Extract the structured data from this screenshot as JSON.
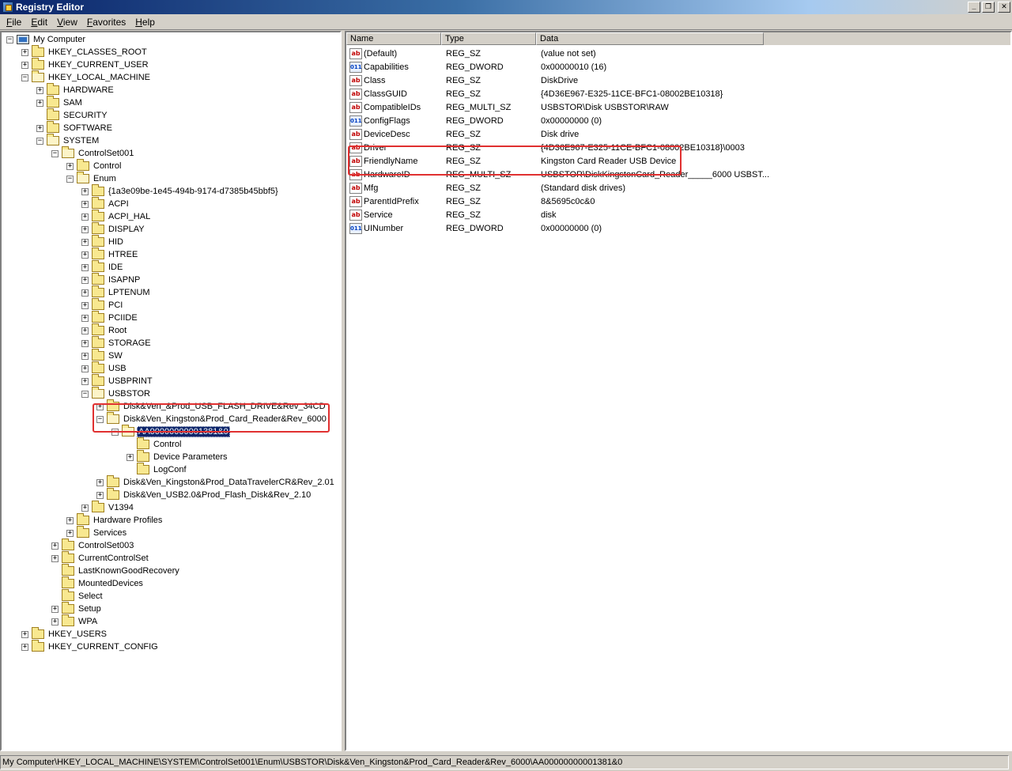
{
  "window": {
    "title": "Registry Editor",
    "icon": "registry-editor-icon",
    "minimize_glyph": "_",
    "maximize_glyph": "❐",
    "close_glyph": "✕"
  },
  "menu": [
    {
      "key": "F",
      "rest": "ile"
    },
    {
      "key": "E",
      "rest": "dit"
    },
    {
      "key": "V",
      "rest": "iew"
    },
    {
      "key": "F",
      "rest": "avorites",
      "prefix": ""
    },
    {
      "key": "H",
      "rest": "elp"
    }
  ],
  "menu_labels": [
    "File",
    "Edit",
    "View",
    "Favorites",
    "Help"
  ],
  "tree": [
    {
      "label": "My Computer",
      "level": 0,
      "expander": "-",
      "icon": "computer-icon"
    },
    {
      "label": "HKEY_CLASSES_ROOT",
      "level": 1,
      "expander": "+"
    },
    {
      "label": "HKEY_CURRENT_USER",
      "level": 1,
      "expander": "+"
    },
    {
      "label": "HKEY_LOCAL_MACHINE",
      "level": 1,
      "expander": "-"
    },
    {
      "label": "HARDWARE",
      "level": 2,
      "expander": "+"
    },
    {
      "label": "SAM",
      "level": 2,
      "expander": "+"
    },
    {
      "label": "SECURITY",
      "level": 2,
      "expander": ""
    },
    {
      "label": "SOFTWARE",
      "level": 2,
      "expander": "+"
    },
    {
      "label": "SYSTEM",
      "level": 2,
      "expander": "-"
    },
    {
      "label": "ControlSet001",
      "level": 3,
      "expander": "-"
    },
    {
      "label": "Control",
      "level": 4,
      "expander": "+"
    },
    {
      "label": "Enum",
      "level": 4,
      "expander": "-"
    },
    {
      "label": "{1a3e09be-1e45-494b-9174-d7385b45bbf5}",
      "level": 5,
      "expander": "+"
    },
    {
      "label": "ACPI",
      "level": 5,
      "expander": "+"
    },
    {
      "label": "ACPI_HAL",
      "level": 5,
      "expander": "+"
    },
    {
      "label": "DISPLAY",
      "level": 5,
      "expander": "+"
    },
    {
      "label": "HID",
      "level": 5,
      "expander": "+"
    },
    {
      "label": "HTREE",
      "level": 5,
      "expander": "+"
    },
    {
      "label": "IDE",
      "level": 5,
      "expander": "+"
    },
    {
      "label": "ISAPNP",
      "level": 5,
      "expander": "+"
    },
    {
      "label": "LPTENUM",
      "level": 5,
      "expander": "+"
    },
    {
      "label": "PCI",
      "level": 5,
      "expander": "+"
    },
    {
      "label": "PCIIDE",
      "level": 5,
      "expander": "+"
    },
    {
      "label": "Root",
      "level": 5,
      "expander": "+"
    },
    {
      "label": "STORAGE",
      "level": 5,
      "expander": "+"
    },
    {
      "label": "SW",
      "level": 5,
      "expander": "+"
    },
    {
      "label": "USB",
      "level": 5,
      "expander": "+"
    },
    {
      "label": "USBPRINT",
      "level": 5,
      "expander": "+"
    },
    {
      "label": "USBSTOR",
      "level": 5,
      "expander": "-"
    },
    {
      "label": "Disk&Ven_&Prod_USB_FLASH_DRIVE&Rev_34CD",
      "level": 6,
      "expander": "+"
    },
    {
      "label": "Disk&Ven_Kingston&Prod_Card_Reader&Rev_6000",
      "level": 6,
      "expander": "-"
    },
    {
      "label": "AA00000000001381&0",
      "level": 7,
      "expander": "-",
      "selected": true
    },
    {
      "label": "Control",
      "level": 8,
      "expander": ""
    },
    {
      "label": "Device Parameters",
      "level": 8,
      "expander": "+"
    },
    {
      "label": "LogConf",
      "level": 8,
      "expander": ""
    },
    {
      "label": "Disk&Ven_Kingston&Prod_DataTravelerCR&Rev_2.01",
      "level": 6,
      "expander": "+"
    },
    {
      "label": "Disk&Ven_USB2.0&Prod_Flash_Disk&Rev_2.10",
      "level": 6,
      "expander": "+"
    },
    {
      "label": "V1394",
      "level": 5,
      "expander": "+"
    },
    {
      "label": "Hardware Profiles",
      "level": 4,
      "expander": "+"
    },
    {
      "label": "Services",
      "level": 4,
      "expander": "+"
    },
    {
      "label": "ControlSet003",
      "level": 3,
      "expander": "+"
    },
    {
      "label": "CurrentControlSet",
      "level": 3,
      "expander": "+"
    },
    {
      "label": "LastKnownGoodRecovery",
      "level": 3,
      "expander": ""
    },
    {
      "label": "MountedDevices",
      "level": 3,
      "expander": ""
    },
    {
      "label": "Select",
      "level": 3,
      "expander": ""
    },
    {
      "label": "Setup",
      "level": 3,
      "expander": "+"
    },
    {
      "label": "WPA",
      "level": 3,
      "expander": "+"
    },
    {
      "label": "HKEY_USERS",
      "level": 1,
      "expander": "+"
    },
    {
      "label": "HKEY_CURRENT_CONFIG",
      "level": 1,
      "expander": "+"
    }
  ],
  "list": {
    "columns": [
      "Name",
      "Type",
      "Data"
    ],
    "rows": [
      {
        "name": "(Default)",
        "type": "REG_SZ",
        "data": "(value not set)",
        "icon": "string-value-icon"
      },
      {
        "name": "Capabilities",
        "type": "REG_DWORD",
        "data": "0x00000010 (16)",
        "icon": "binary-value-icon"
      },
      {
        "name": "Class",
        "type": "REG_SZ",
        "data": "DiskDrive",
        "icon": "string-value-icon"
      },
      {
        "name": "ClassGUID",
        "type": "REG_SZ",
        "data": "{4D36E967-E325-11CE-BFC1-08002BE10318}",
        "icon": "string-value-icon"
      },
      {
        "name": "CompatibleIDs",
        "type": "REG_MULTI_SZ",
        "data": "USBSTOR\\Disk USBSTOR\\RAW",
        "icon": "string-value-icon"
      },
      {
        "name": "ConfigFlags",
        "type": "REG_DWORD",
        "data": "0x00000000 (0)",
        "icon": "binary-value-icon"
      },
      {
        "name": "DeviceDesc",
        "type": "REG_SZ",
        "data": "Disk drive",
        "icon": "string-value-icon"
      },
      {
        "name": "Driver",
        "type": "REG_SZ",
        "data": "{4D36E967-E325-11CE-BFC1-08002BE10318}\\0003",
        "icon": "string-value-icon"
      },
      {
        "name": "FriendlyName",
        "type": "REG_SZ",
        "data": "Kingston Card Reader USB Device",
        "icon": "string-value-icon"
      },
      {
        "name": "HardwareID",
        "type": "REG_MULTI_SZ",
        "data": "USBSTOR\\DiskKingstonCard_Reader_____6000 USBST...",
        "icon": "string-value-icon"
      },
      {
        "name": "Mfg",
        "type": "REG_SZ",
        "data": "(Standard disk drives)",
        "icon": "string-value-icon"
      },
      {
        "name": "ParentIdPrefix",
        "type": "REG_SZ",
        "data": "8&5695c0c&0",
        "icon": "string-value-icon"
      },
      {
        "name": "Service",
        "type": "REG_SZ",
        "data": "disk",
        "icon": "string-value-icon"
      },
      {
        "name": "UINumber",
        "type": "REG_DWORD",
        "data": "0x00000000 (0)",
        "icon": "binary-value-icon"
      }
    ]
  },
  "icon_glyphs": {
    "string": "ab",
    "binary": "011"
  },
  "status": "My Computer\\HKEY_LOCAL_MACHINE\\SYSTEM\\ControlSet001\\Enum\\USBSTOR\\Disk&Ven_Kingston&Prod_Card_Reader&Rev_6000\\AA00000000001381&0",
  "colors": {
    "highlight_box": "#e03030",
    "selection": "#0a246a"
  }
}
